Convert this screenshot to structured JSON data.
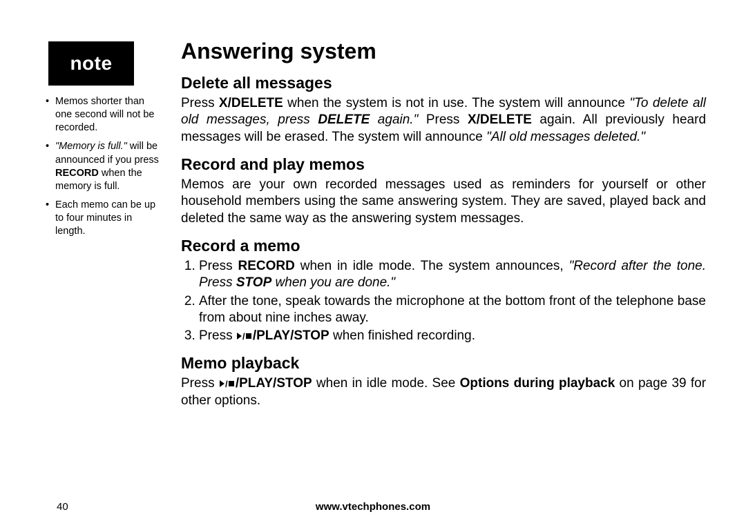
{
  "sidebar": {
    "badge": "note",
    "notes": {
      "n1": "Memos shorter than one second will not be recorded.",
      "n2_quote": "\"Memory is full.\"",
      "n2_mid": " will be announced if you press ",
      "n2_bold": "RECORD",
      "n2_end": " when the memory is full.",
      "n3": "Each memo can be up to four minutes in length."
    }
  },
  "main": {
    "title": "Answering system",
    "delete": {
      "heading": "Delete all messages",
      "p1a": "Press ",
      "p1b": "X/DELETE",
      "p1c": " when the system is not in use. The system will announce ",
      "p1d": "\"To delete all old messages, press ",
      "p1e": "DELETE",
      "p1f": " again.\"",
      "p1g": " Press ",
      "p1h": "X/DELETE",
      "p1i": " again. All previously heard messages will be erased. The system will announce ",
      "p1j": "\"All old messages deleted.\""
    },
    "recplay": {
      "heading": "Record and play memos",
      "p": "Memos are your own recorded messages used as reminders for yourself or other household members using the same answering system. They are saved, played back and deleted the same way as the answering system messages."
    },
    "recmemo": {
      "heading": "Record a memo",
      "s1a": "Press ",
      "s1b": "RECORD",
      "s1c": " when in idle mode. The system announces, ",
      "s1d": "\"Record after the tone. Press ",
      "s1e": "STOP",
      "s1f": " when you are done.\"",
      "s2": "After the tone, speak towards the microphone at the bottom front of the telephone base from about nine inches away.",
      "s3a": "Press ",
      "s3b": "/PLAY/STOP",
      "s3c": " when finished recording."
    },
    "playback": {
      "heading": "Memo playback",
      "p1a": "Press ",
      "p1b": "/PLAY/STOP",
      "p1c": " when in idle mode. See ",
      "p1d": "Options during playback",
      "p1e": " on page 39 for other options."
    }
  },
  "footer": {
    "page": "40",
    "url": "www.vtechphones.com"
  }
}
